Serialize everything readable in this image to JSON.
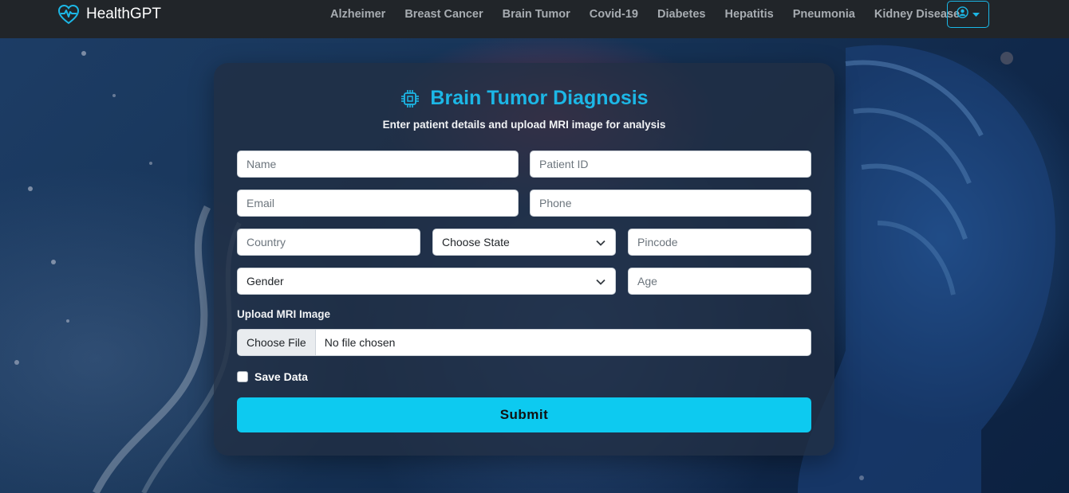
{
  "colors": {
    "navbar_bg": "#212529",
    "accent": "#1cb7e6",
    "submit_bg": "#0dcaf0",
    "card_bg": "rgba(33,46,66,0.78)"
  },
  "navbar": {
    "brand": "HealthGPT",
    "brand_icon": "heart-pulse-icon",
    "links": [
      {
        "label": "Alzheimer"
      },
      {
        "label": "Breast Cancer"
      },
      {
        "label": "Brain Tumor"
      },
      {
        "label": "Covid-19"
      },
      {
        "label": "Diabetes"
      },
      {
        "label": "Hepatitis"
      },
      {
        "label": "Pneumonia"
      },
      {
        "label": "Kidney Disease"
      }
    ],
    "user_icon": "user-circle-icon"
  },
  "form": {
    "title": "Brain Tumor Diagnosis",
    "title_icon": "chip-icon",
    "subtitle": "Enter patient details and upload MRI image for analysis",
    "name_placeholder": "Name",
    "patient_id_placeholder": "Patient ID",
    "email_placeholder": "Email",
    "phone_placeholder": "Phone",
    "country_placeholder": "Country",
    "state_value": "Choose State",
    "pincode_placeholder": "Pincode",
    "gender_value": "Gender",
    "age_placeholder": "Age",
    "upload_label": "Upload MRI Image",
    "file_button": "Choose File",
    "file_status": "No file chosen",
    "save_label": "Save Data",
    "save_checked": false,
    "submit_label": "Submit"
  }
}
